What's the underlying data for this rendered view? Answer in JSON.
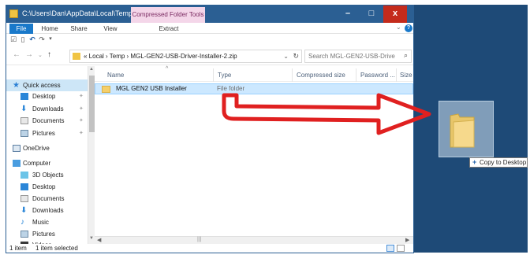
{
  "titlebar": {
    "path": "C:\\Users\\Dan\\AppData\\Local\\Temp...",
    "context_tab": "Compressed Folder Tools",
    "minimize": "–",
    "maximize": "□",
    "close": "x"
  },
  "ribbon": {
    "tabs": [
      "File",
      "Home",
      "Share",
      "View",
      "Extract"
    ]
  },
  "address": {
    "crumbs": "« Local › Temp › MGL-GEN2-USB-Driver-Installer-2.zip",
    "search_placeholder": "Search MGL-GEN2-USB-Drive..."
  },
  "navpane": {
    "items": [
      {
        "label": "Quick access",
        "icon": "star-icon"
      },
      {
        "label": "Desktop",
        "icon": "desktop-icon"
      },
      {
        "label": "Downloads",
        "icon": "download-icon"
      },
      {
        "label": "Documents",
        "icon": "documents-icon"
      },
      {
        "label": "Pictures",
        "icon": "pictures-icon"
      },
      {
        "label": "OneDrive",
        "icon": "onedrive-icon"
      },
      {
        "label": "Computer",
        "icon": "computer-icon"
      },
      {
        "label": "3D Objects",
        "icon": "3d-objects-icon"
      },
      {
        "label": "Desktop",
        "icon": "desktop-icon"
      },
      {
        "label": "Documents",
        "icon": "documents-icon"
      },
      {
        "label": "Downloads",
        "icon": "download-icon"
      },
      {
        "label": "Music",
        "icon": "music-icon"
      },
      {
        "label": "Pictures",
        "icon": "pictures-icon"
      },
      {
        "label": "Videos",
        "icon": "videos-icon"
      }
    ]
  },
  "columns": [
    "Name",
    "Type",
    "Compressed size",
    "Password ...",
    "Size"
  ],
  "rows": [
    {
      "name": "MGL GEN2 USB Installer",
      "type": "File folder"
    }
  ],
  "status": {
    "count": "1 item",
    "selected": "1 item selected"
  },
  "drag": {
    "tooltip": "Copy to Desktop"
  },
  "colors": {
    "titlebar": "#2b5f93",
    "desktop": "#1e4a77",
    "arrow": "#e02020",
    "selection": "#cce8ff"
  }
}
